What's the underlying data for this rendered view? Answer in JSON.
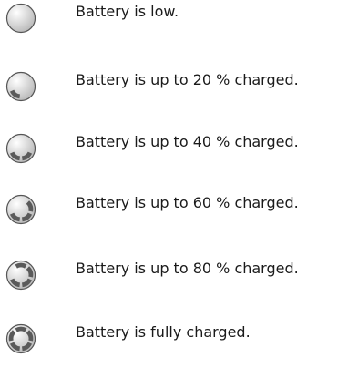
{
  "battery_legend": {
    "items": [
      {
        "icon": "battery-empty-icon",
        "charge_level_percent": 0,
        "text": "Battery is low."
      },
      {
        "icon": "battery-20-icon",
        "charge_level_percent": 20,
        "text": "Battery is up to 20 % charged."
      },
      {
        "icon": "battery-40-icon",
        "charge_level_percent": 40,
        "text": "Battery is up to 40 % charged."
      },
      {
        "icon": "battery-60-icon",
        "charge_level_percent": 60,
        "text": "Battery is up to 60 % charged."
      },
      {
        "icon": "battery-80-icon",
        "charge_level_percent": 80,
        "text": "Battery is up to 80 % charged."
      },
      {
        "icon": "battery-full-icon",
        "charge_level_percent": 100,
        "text": "Battery is fully charged."
      }
    ],
    "colors": {
      "outline": "#555555",
      "segment_fill": "#5a5a5a",
      "gradient_light": "#ffffff",
      "gradient_dark": "#b8b8b8"
    }
  }
}
